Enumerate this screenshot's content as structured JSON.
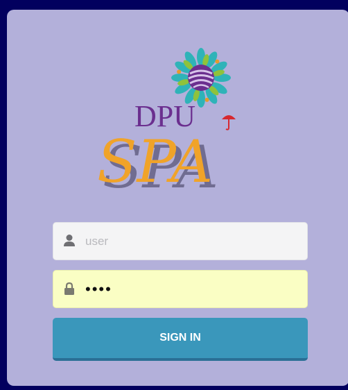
{
  "logo": {
    "text_top": "DPU",
    "text_bottom": "SPA"
  },
  "login": {
    "username_placeholder": "user",
    "username_value": "",
    "password_value": "....",
    "signin_label": "SIGN IN"
  },
  "icons": {
    "user": "user-icon",
    "lock": "lock-icon"
  },
  "colors": {
    "page_background": "#02005e",
    "card_background": "#b3b0da",
    "button": "#3a97bb",
    "password_field": "#fafec4"
  }
}
